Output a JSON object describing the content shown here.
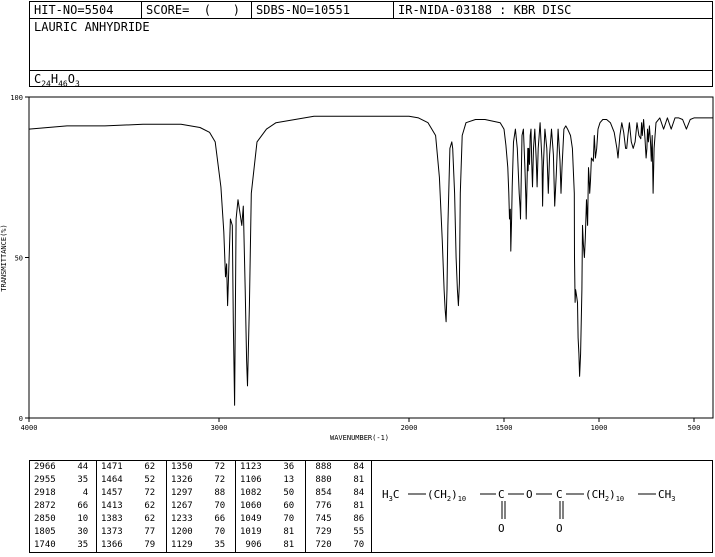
{
  "header": {
    "hit_no": "HIT-NO=5504",
    "score": "SCORE=  (   )",
    "sdbs_no": "SDBS-NO=10551",
    "ir_info": "IR-NIDA-03188 : KBR DISC"
  },
  "compound_name": "LAURIC ANHYDRIDE",
  "formula": {
    "c": "C",
    "c_n": "24",
    "h": "H",
    "h_n": "46",
    "o": "O",
    "o_n": "3"
  },
  "chart_data": {
    "type": "line",
    "title": "",
    "xlabel": "WAVENUMBER(-1)",
    "ylabel": "TRANSMITTANCE(%)",
    "xlim": [
      4000,
      400
    ],
    "ylim": [
      0,
      100
    ],
    "x_ticks": [
      4000,
      3000,
      2000,
      1500,
      1000,
      500
    ],
    "y_ticks": [
      0,
      50,
      100
    ],
    "grid": false,
    "series": [
      {
        "x": [
          4000,
          3800,
          3600,
          3400,
          3200,
          3100,
          3050,
          3020,
          2990,
          2975,
          2966,
          2960,
          2955,
          2940,
          2930,
          2925,
          2918,
          2910,
          2900,
          2890,
          2880,
          2872,
          2862,
          2855,
          2850,
          2840,
          2830,
          2800,
          2750,
          2700,
          2600,
          2500,
          2400,
          2300,
          2200,
          2100,
          2000,
          1950,
          1900,
          1860,
          1840,
          1825,
          1815,
          1810,
          1805,
          1800,
          1795,
          1785,
          1775,
          1770,
          1760,
          1752,
          1745,
          1740,
          1735,
          1730,
          1720,
          1700,
          1650,
          1600,
          1560,
          1520,
          1500,
          1490,
          1480,
          1475,
          1471,
          1467,
          1464,
          1460,
          1457,
          1450,
          1440,
          1430,
          1420,
          1415,
          1413,
          1410,
          1405,
          1398,
          1390,
          1385,
          1383,
          1380,
          1375,
          1373,
          1370,
          1366,
          1362,
          1358,
          1354,
          1350,
          1345,
          1338,
          1330,
          1326,
          1320,
          1310,
          1300,
          1297,
          1293,
          1285,
          1275,
          1267,
          1260,
          1250,
          1240,
          1233,
          1225,
          1215,
          1205,
          1200,
          1195,
          1185,
          1175,
          1165,
          1150,
          1140,
          1130,
          1129,
          1126,
          1123,
          1118,
          1113,
          1110,
          1106,
          1102,
          1097,
          1090,
          1087,
          1082,
          1077,
          1072,
          1066,
          1060,
          1055,
          1052,
          1049,
          1045,
          1040,
          1030,
          1025,
          1019,
          1012,
          1005,
          995,
          980,
          960,
          940,
          920,
          906,
          900,
          890,
          880,
          870,
          860,
          854,
          848,
          840,
          830,
          820,
          810,
          800,
          790,
          780,
          776,
          772,
          765,
          758,
          752,
          748,
          745,
          740,
          735,
          729,
          725,
          720,
          715,
          710,
          700,
          680,
          660,
          640,
          620,
          600,
          580,
          560,
          540,
          520,
          500,
          480,
          460,
          440,
          420,
          400
        ],
        "y": [
          90,
          91,
          91,
          91.5,
          91.5,
          90.5,
          89,
          86,
          72,
          58,
          44,
          48,
          35,
          62,
          60,
          30,
          4,
          62,
          68,
          64,
          60,
          66,
          40,
          18,
          10,
          35,
          70,
          86,
          90,
          92,
          93,
          94,
          94,
          94,
          94,
          94,
          94,
          93.5,
          92,
          88,
          75,
          55,
          40,
          34,
          30,
          40,
          60,
          84,
          86,
          84,
          70,
          50,
          40,
          35,
          42,
          70,
          88,
          92,
          93,
          93,
          92.5,
          92,
          90,
          85,
          78,
          70,
          62,
          65,
          52,
          62,
          72,
          86,
          90,
          84,
          70,
          65,
          62,
          72,
          88,
          90,
          78,
          68,
          62,
          70,
          84,
          77,
          84,
          79,
          88,
          90,
          80,
          72,
          84,
          90,
          80,
          72,
          84,
          92,
          80,
          66,
          78,
          90,
          84,
          70,
          82,
          90,
          82,
          66,
          76,
          90,
          80,
          70,
          78,
          90,
          91,
          90,
          88,
          84,
          70,
          50,
          36,
          40,
          38,
          36,
          25,
          20,
          13,
          20,
          40,
          60,
          54,
          50,
          56,
          68,
          60,
          78,
          75,
          70,
          74,
          81,
          80,
          88,
          81,
          84,
          90,
          92,
          93,
          93,
          92,
          89,
          84,
          81,
          88,
          92,
          89,
          84,
          84,
          88,
          92,
          86,
          84,
          86,
          92,
          88,
          87,
          92,
          88,
          93,
          87,
          81,
          84,
          90,
          86,
          91,
          86,
          80,
          88,
          70,
          84,
          92,
          93.5,
          90,
          93.5,
          90,
          93.5,
          93.5,
          93,
          90,
          93,
          93.5,
          93.5,
          93.5,
          93.5,
          93.5,
          93.5
        ]
      }
    ]
  },
  "peak_table": [
    [
      [
        "2966",
        "44"
      ],
      [
        "2955",
        "35"
      ],
      [
        "2918",
        "4"
      ],
      [
        "2872",
        "66"
      ],
      [
        "2850",
        "10"
      ],
      [
        "1805",
        "30"
      ],
      [
        "1740",
        "35"
      ]
    ],
    [
      [
        "1471",
        "62"
      ],
      [
        "1464",
        "52"
      ],
      [
        "1457",
        "72"
      ],
      [
        "1413",
        "62"
      ],
      [
        "1383",
        "62"
      ],
      [
        "1373",
        "77"
      ],
      [
        "1366",
        "79"
      ]
    ],
    [
      [
        "1350",
        "72"
      ],
      [
        "1326",
        "72"
      ],
      [
        "1297",
        "88"
      ],
      [
        "1267",
        "70"
      ],
      [
        "1233",
        "66"
      ],
      [
        "1200",
        "70"
      ],
      [
        "1129",
        "35"
      ]
    ],
    [
      [
        "1123",
        "36"
      ],
      [
        "1106",
        "13"
      ],
      [
        "1082",
        "50"
      ],
      [
        "1060",
        "60"
      ],
      [
        "1049",
        "70"
      ],
      [
        "1019",
        "81"
      ],
      [
        "906",
        "81"
      ]
    ],
    [
      [
        "888",
        "84"
      ],
      [
        "880",
        "81"
      ],
      [
        "854",
        "84"
      ],
      [
        "776",
        "81"
      ],
      [
        "745",
        "86"
      ],
      [
        "729",
        "55"
      ],
      [
        "720",
        "70"
      ]
    ]
  ],
  "structure": {
    "h3c": "H",
    "h3c_sub": "3",
    "h3c_c": "C",
    "paren_ch2_1": "(CH",
    "paren_sub_1": "2",
    "paren_close_1": ")",
    "n1": "10",
    "c1": "C",
    "o_bridge": "O",
    "c2": "C",
    "paren_ch2_2": "(CH",
    "paren_sub_2": "2",
    "paren_close_2": ")",
    "n2": "10",
    "ch3": "CH",
    "ch3_sub": "3",
    "o1": "O",
    "o2": "O"
  }
}
